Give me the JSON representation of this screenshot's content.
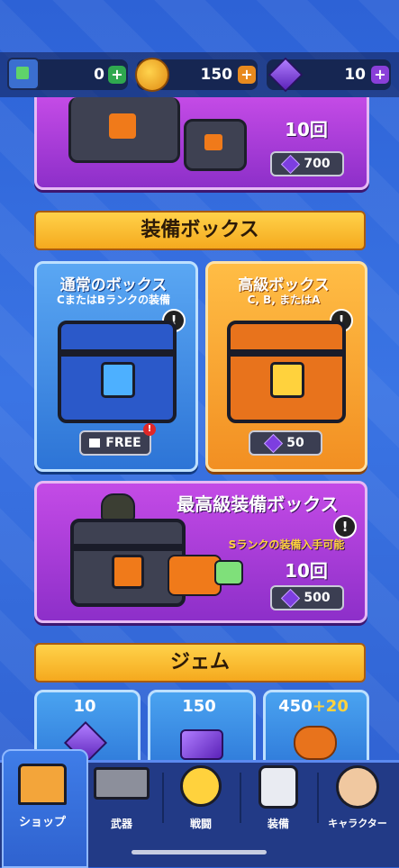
{
  "currency": {
    "cubes": "0",
    "coins": "150",
    "gems": "10",
    "plus": "+",
    "colors": {
      "cubes_plus": "#2fa84f",
      "coins_plus": "#e88a1f",
      "gems_plus": "#8a3fd9"
    }
  },
  "top_offer": {
    "count": "10回",
    "price": "700"
  },
  "equipment_section": {
    "title": "装備ボックス",
    "normal": {
      "title": "通常のボックス",
      "subtitle": "CまたはBランクの装備",
      "button": "FREE",
      "info": "!"
    },
    "premium": {
      "title": "高級ボックス",
      "subtitle": "C, B, またはA",
      "price": "50",
      "info": "!"
    },
    "ultimate": {
      "title": "最高級装備ボックス",
      "subtitle": "Sランクの装備入手可能",
      "count": "10回",
      "price": "500",
      "info": "!"
    }
  },
  "gem_section": {
    "title": "ジェム",
    "packs": [
      {
        "amount": "10"
      },
      {
        "amount": "150"
      },
      {
        "amount": "450",
        "bonus": "+20"
      }
    ]
  },
  "nav": {
    "items": [
      {
        "label": "ショップ"
      },
      {
        "label": "武器"
      },
      {
        "label": "戦闘"
      },
      {
        "label": "装備"
      },
      {
        "label": "キャラクター"
      }
    ],
    "active": "ショップ"
  },
  "colors": {
    "accent_yellow": "#ffd24a",
    "purple": "#a63bd7",
    "blue_card": "#3d8fe8",
    "orange_card": "#f7a635"
  }
}
